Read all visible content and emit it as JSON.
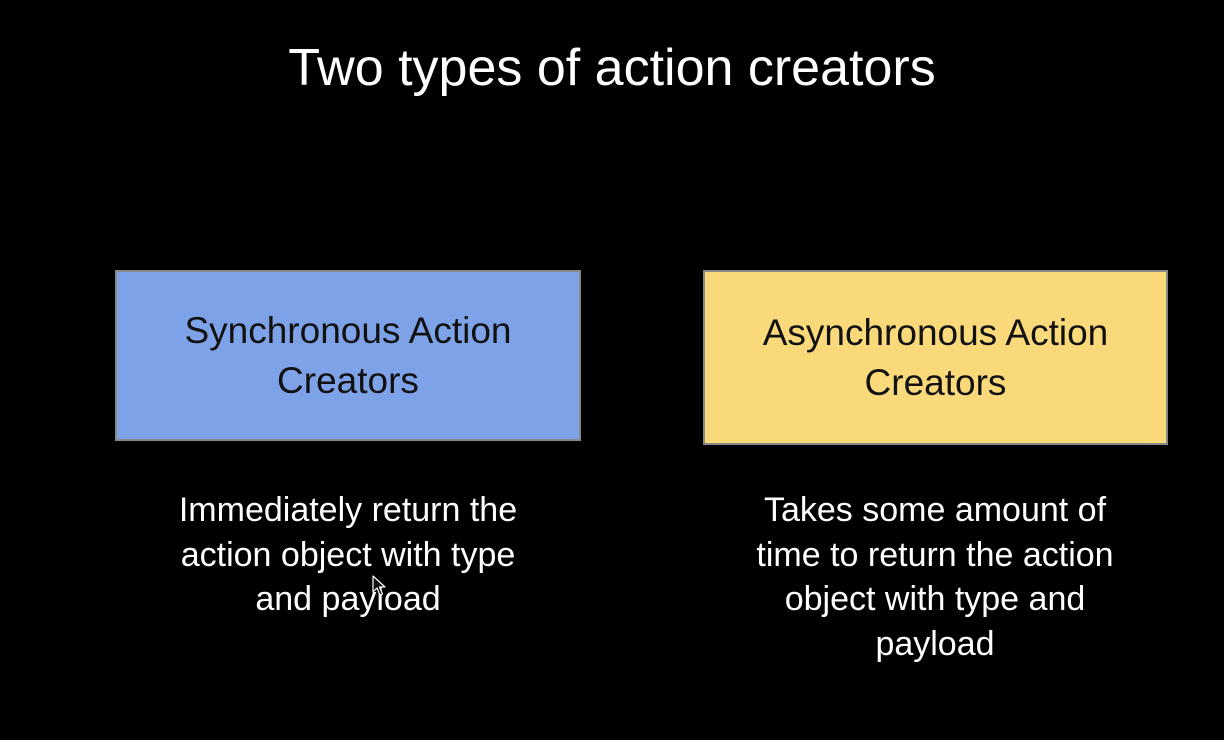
{
  "slide": {
    "title": "Two types of action creators",
    "colors": {
      "background": "#000000",
      "text": "#ffffff",
      "sync_box": "#7da2e8",
      "async_box": "#f9d97a",
      "box_text": "#111111"
    },
    "cards": [
      {
        "label": "Synchronous Action Creators",
        "description": "Immediately return the action object with type and payload"
      },
      {
        "label": "Asynchronous Action Creators",
        "description": "Takes some amount of time to return the action object with type and payload"
      }
    ],
    "cursor_icon": "mouse-pointer-icon"
  }
}
